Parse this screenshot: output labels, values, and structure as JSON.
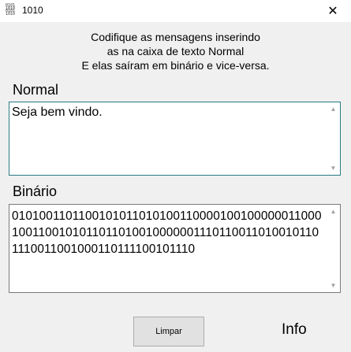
{
  "window": {
    "title": "1010",
    "icon": "binary-grid-icon",
    "close_glyph": "✕"
  },
  "intro": {
    "lines": [
      "Codifique as mensagens inserindo",
      "as na caixa de texto Normal",
      "E elas saíram em binário e vice-versa."
    ]
  },
  "normal": {
    "label": "Normal",
    "value": "Seja bem vindo."
  },
  "binary": {
    "label": "Binário",
    "value": "010100110110010101101010011000010010000001100010011001010110110100100000011101100110100101101110011001000110111100101110"
  },
  "buttons": {
    "clear_label": "Limpar",
    "info_label": "Info"
  },
  "colors": {
    "background": "#f0f0f0",
    "normal_border_focus": "#2a7a86",
    "binary_border": "#7a7a7a"
  }
}
